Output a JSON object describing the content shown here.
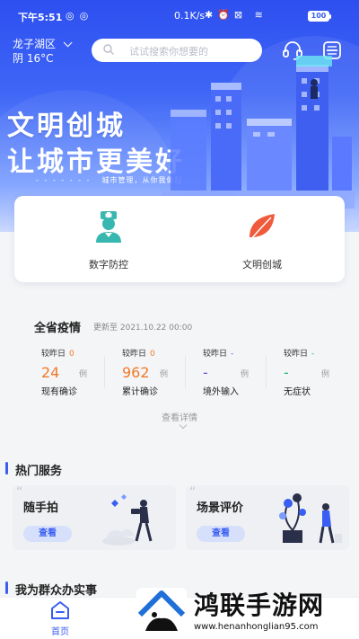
{
  "status_bar": {
    "time": "下午5:51",
    "network_speed": "0.1K/s",
    "battery": "100"
  },
  "header": {
    "location": "龙子湖区",
    "weather": "阴 16°C",
    "search_placeholder": "试试搜索你想要的"
  },
  "banner": {
    "title_line1": "文明创城",
    "title_line2": "让城市更美好",
    "subtitle": "城市管理，从你我做起"
  },
  "quick_entries": [
    {
      "label": "数字防控",
      "icon": "doctor-icon"
    },
    {
      "label": "文明创城",
      "icon": "leaf-icon"
    }
  ],
  "epidemic": {
    "title": "全省疫情",
    "update_text": "更新至 2021.10.22 00:00",
    "stats": [
      {
        "compare_label": "较昨日",
        "compare_value": "0",
        "value": "24",
        "unit": "例",
        "label": "现有确诊",
        "color": "#f07a2a"
      },
      {
        "compare_label": "较昨日",
        "compare_value": "0",
        "value": "962",
        "unit": "例",
        "label": "累计确诊",
        "color": "#f07a2a"
      },
      {
        "compare_label": "较昨日",
        "compare_value": "-",
        "value": "-",
        "unit": "例",
        "label": "境外输入",
        "color": "#7c4dd8"
      },
      {
        "compare_label": "较昨日",
        "compare_value": "-",
        "value": "-",
        "unit": "例",
        "label": "无症状",
        "color": "#2bb673"
      }
    ],
    "more_label": "查看详情"
  },
  "hot_services": {
    "title": "热门服务",
    "items": [
      {
        "title": "随手拍",
        "button": "查看"
      },
      {
        "title": "场景评价",
        "button": "查看"
      }
    ]
  },
  "serve_section": {
    "title": "我为群众办实事"
  },
  "tabbar": {
    "home_label": "首页"
  },
  "watermark": {
    "text": "鸿联手游网",
    "url": "www.henanhonglian95.com"
  },
  "colors": {
    "accent": "#3a5ef2",
    "orange": "#f07a2a",
    "purple": "#7c4dd8",
    "green": "#2bb673"
  }
}
